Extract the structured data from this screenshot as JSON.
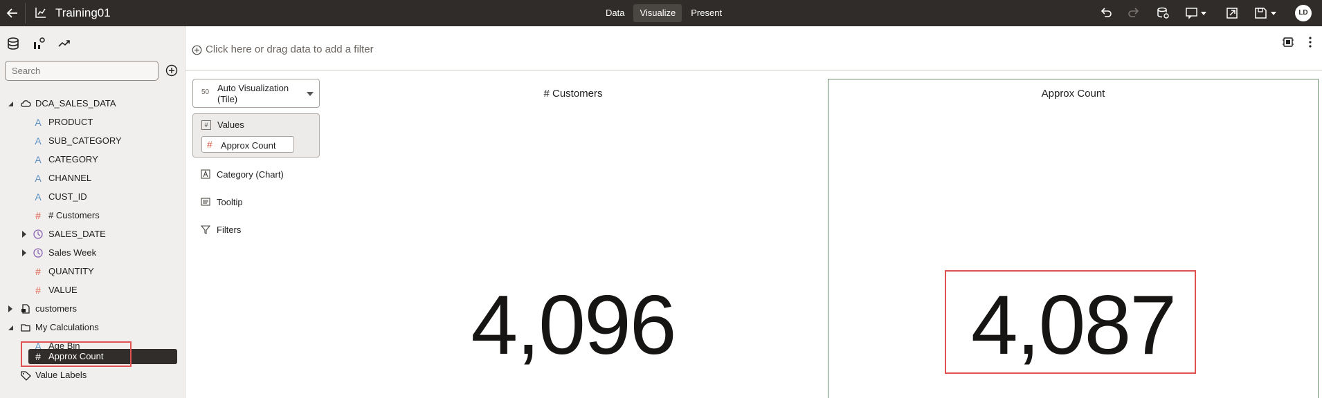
{
  "app": {
    "title": "Training01",
    "back_icon": "arrow-left-icon",
    "app_icon": "workbook-chart-icon"
  },
  "mode_tabs": [
    {
      "label": "Data",
      "active": false
    },
    {
      "label": "Visualize",
      "active": true
    },
    {
      "label": "Present",
      "active": false
    }
  ],
  "user": {
    "initials": "LD"
  },
  "left_panel": {
    "search": {
      "placeholder": "Search",
      "value": ""
    },
    "tree": {
      "dataset": "DCA_SALES_DATA",
      "columns": [
        {
          "label": "PRODUCT",
          "type": "attribute"
        },
        {
          "label": "SUB_CATEGORY",
          "type": "attribute"
        },
        {
          "label": "CATEGORY",
          "type": "attribute"
        },
        {
          "label": "CHANNEL",
          "type": "attribute"
        },
        {
          "label": "CUST_ID",
          "type": "attribute"
        },
        {
          "label": "# Customers",
          "type": "measure"
        },
        {
          "label": "SALES_DATE",
          "type": "time"
        },
        {
          "label": "Sales Week",
          "type": "time"
        },
        {
          "label": "QUANTITY",
          "type": "measure"
        },
        {
          "label": "VALUE",
          "type": "measure"
        }
      ],
      "customers": "customers",
      "my_calculations": "My Calculations",
      "calculations": [
        {
          "label": "Age Bin",
          "type": "attribute"
        },
        {
          "label": "Approx Count",
          "type": "measure",
          "selected": true
        }
      ],
      "value_labels": "Value Labels"
    }
  },
  "filter_bar": {
    "text": "Click here or drag data to add a filter"
  },
  "grammar": {
    "viz_type": "Auto Visualization (Tile)",
    "values_label": "Values",
    "values_pill": "Approx Count",
    "category_label": "Category (Chart)",
    "tooltip_label": "Tooltip",
    "filters_label": "Filters"
  },
  "tiles": [
    {
      "title": "# Customers",
      "value": "4,096"
    },
    {
      "title": "Approx Count",
      "value": "4,087"
    }
  ],
  "colors": {
    "topbar": "#2f2c29",
    "measure": "#e0654f",
    "attribute": "#5a8fc2",
    "time": "#8a63b5",
    "highlight": "#e05252"
  }
}
